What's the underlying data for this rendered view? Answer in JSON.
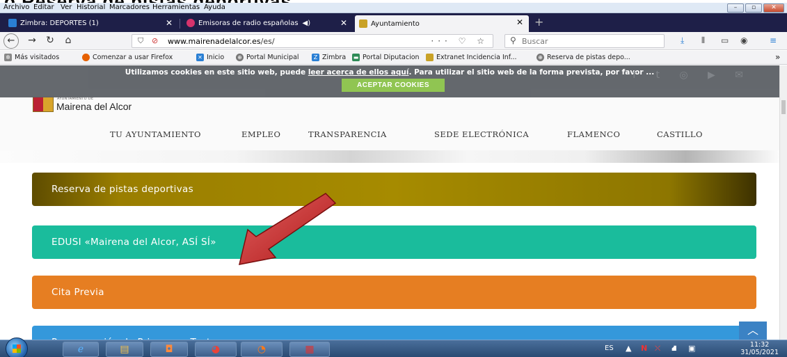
{
  "caption": "o Reserva de pistas deportivas",
  "menu": [
    "Archivo",
    "Editar",
    "Ver",
    "Historial",
    "Marcadores",
    "Herramientas",
    "Ayuda"
  ],
  "tabs": [
    {
      "label": "Zimbra: DEPORTES (1)",
      "color": "#2a7fd4"
    },
    {
      "label": "Emisoras de radio españolas",
      "color": "#d6336c"
    },
    {
      "label": "Ayuntamiento",
      "color": "#c9a227"
    }
  ],
  "nav": {
    "url_host": "www.mairenadelalcor.es",
    "url_path": "/es/",
    "search_placeholder": "Buscar"
  },
  "bookmarks": [
    {
      "label": "Más visitados",
      "icon": "gear-icon",
      "color": "#888"
    },
    {
      "label": "Comenzar a usar Firefox",
      "icon": "firefox-icon",
      "color": "#e66000"
    },
    {
      "label": "Inicio",
      "icon": "home-icon",
      "color": "#2a7fd4"
    },
    {
      "label": "Portal Municipal",
      "icon": "globe-icon",
      "color": "#555"
    },
    {
      "label": "Zimbra",
      "icon": "zimbra-icon",
      "color": "#2a7fd4"
    },
    {
      "label": "Portal Diputacion",
      "icon": "portal-icon",
      "color": "#2e8b57"
    },
    {
      "label": "Extranet Incidencia Inf...",
      "icon": "crest-icon",
      "color": "#c9a227"
    },
    {
      "label": "Reserva de pistas depo...",
      "icon": "globe-icon",
      "color": "#555"
    }
  ],
  "cookies": {
    "text_before": "Utilizamos cookies en este sitio web, puede ",
    "link": "leer acerca de ellos aquí",
    "text_after": ". Para utilizar el sitio web de la forma prevista, por favor ...",
    "button": "ACEPTAR COOKIES"
  },
  "logo": {
    "small": "AYUNTAMIENTO DE",
    "big": "Mairena del Alcor"
  },
  "site_nav": [
    "TU AYUNTAMIENTO",
    "EMPLEO",
    "TRANSPARENCIA",
    "SEDE ELECTRÓNICA",
    "FLAMENCO",
    "CASTILLO"
  ],
  "blocks": [
    {
      "label": "Reserva de pistas deportivas",
      "color": "#a68b00"
    },
    {
      "label": "EDUSI «Mairena del Alcor, ASÍ SÍ»",
      "color": "#1abc9c"
    },
    {
      "label": "Cita Previa",
      "color": "#e67e22"
    },
    {
      "label": "Programación de Primavera Teatro",
      "color": "#3498db"
    }
  ],
  "tray": {
    "lang": "ES",
    "time": "11:32",
    "date": "31/05/2021"
  }
}
